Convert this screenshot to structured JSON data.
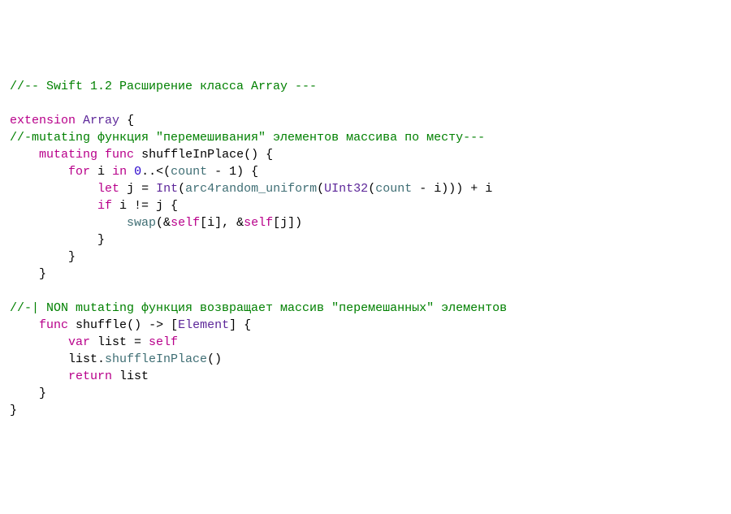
{
  "code": {
    "line1_comment": "//-- Swift 1.2 Расширение класса Array ---",
    "line3_kw_extension": "extension",
    "line3_type_array": "Array",
    "line4_comment": "//-mutating функция \"перемешивания\" элементов массива по месту---",
    "line5_kw_mutating": "mutating",
    "line5_kw_func": "func",
    "line5_fn": "shuffleInPlace",
    "line6_kw_for": "for",
    "line6_ident_i": "i",
    "line6_kw_in": "in",
    "line6_num0": "0",
    "line6_range": "..<(",
    "line6_count": "count",
    "line6_minus_one": " - 1) {",
    "line7_kw_let": "let",
    "line7_j": "j",
    "line7_eq": " = ",
    "line7_Int": "Int",
    "line7_open": "(",
    "line7_arc": "arc4random_uniform",
    "line7_open2": "(",
    "line7_UInt32": "UInt32",
    "line7_open3": "(",
    "line7_count": "count",
    "line7_minus_i": " - i))) + i",
    "line8_kw_if": "if",
    "line8_cond": " i != j {",
    "line9_swap": "swap",
    "line9_args_open": "(&",
    "line9_self1": "self",
    "line9_sub1": "[i], &",
    "line9_self2": "self",
    "line9_sub2": "[j])",
    "line10_brace": "}",
    "line11_brace": "}",
    "line12_brace": "}",
    "line14_comment": "//-| NON mutating функция возвращает массив \"перемешанных\" элементов",
    "line15_kw_func": "func",
    "line15_fn": "shuffle",
    "line15_arrow": "() -> [",
    "line15_Element": "Element",
    "line15_close": "] {",
    "line16_kw_var": "var",
    "line16_list": " list = ",
    "line16_self": "self",
    "line17_list": "list.",
    "line17_call": "shuffleInPlace",
    "line17_parens": "()",
    "line18_kw_return": "return",
    "line18_list": " list",
    "line19_brace": "}",
    "line20_brace": "}"
  }
}
